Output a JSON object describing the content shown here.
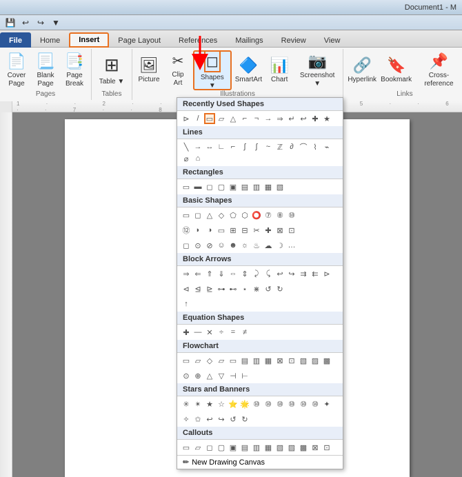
{
  "titlebar": {
    "title": "Document1 - M"
  },
  "quickaccess": {
    "buttons": [
      "save",
      "undo",
      "redo",
      "customize"
    ]
  },
  "tabs": [
    {
      "id": "file",
      "label": "File"
    },
    {
      "id": "home",
      "label": "Home"
    },
    {
      "id": "insert",
      "label": "Insert",
      "active": true
    },
    {
      "id": "page-layout",
      "label": "Page Layout"
    },
    {
      "id": "references",
      "label": "References"
    },
    {
      "id": "mailings",
      "label": "Mailings"
    },
    {
      "id": "review",
      "label": "Review"
    },
    {
      "id": "view",
      "label": "View"
    }
  ],
  "ribbon": {
    "groups": [
      {
        "id": "pages",
        "label": "Pages",
        "buttons": [
          {
            "id": "cover-page",
            "label": "Cover\nPage",
            "icon": "📄"
          },
          {
            "id": "blank-page",
            "label": "Blank\nPage",
            "icon": "📃"
          },
          {
            "id": "page-break",
            "label": "Page\nBreak",
            "icon": "📑"
          }
        ]
      },
      {
        "id": "tables",
        "label": "Tables",
        "buttons": [
          {
            "id": "table",
            "label": "Table",
            "icon": "⊞"
          }
        ]
      },
      {
        "id": "illustrations",
        "label": "Illustrations",
        "buttons": [
          {
            "id": "picture",
            "label": "Picture",
            "icon": "🖼"
          },
          {
            "id": "clip-art",
            "label": "Clip\nArt",
            "icon": "✂"
          },
          {
            "id": "shapes",
            "label": "Shapes",
            "icon": "◻",
            "active": true
          },
          {
            "id": "smartart",
            "label": "SmartArt",
            "icon": "🔷"
          },
          {
            "id": "chart",
            "label": "Chart",
            "icon": "📊"
          },
          {
            "id": "screenshot",
            "label": "Screenshot",
            "icon": "📷"
          }
        ]
      },
      {
        "id": "links",
        "label": "Links",
        "buttons": [
          {
            "id": "hyperlink",
            "label": "Hyperlink",
            "icon": "🔗"
          },
          {
            "id": "bookmark",
            "label": "Bookmark",
            "icon": "🔖"
          },
          {
            "id": "cross-reference",
            "label": "Cross-reference",
            "icon": "📌"
          }
        ]
      }
    ]
  },
  "shapes_dropdown": {
    "title": "Recently Used Shapes",
    "sections": [
      {
        "id": "recently-used",
        "label": "Recently Used Shapes",
        "shapes": [
          "◸",
          "╲",
          "▭",
          "▱",
          "△",
          "⌐",
          "⌐",
          "→",
          "⇒",
          "↵",
          "↩",
          "⊹",
          "★"
        ]
      },
      {
        "id": "lines",
        "label": "Lines",
        "shapes": [
          "╲",
          "╲╲",
          "∫∫",
          "∫",
          "∫",
          "∫",
          "∫",
          "~",
          "~",
          "~",
          "~",
          "~",
          "~",
          "~",
          "~"
        ]
      },
      {
        "id": "rectangles",
        "label": "Rectangles",
        "shapes": [
          "▭",
          "▭",
          "▭",
          "▭",
          "▭",
          "▭",
          "▭",
          "▭",
          "▭"
        ]
      },
      {
        "id": "basic-shapes",
        "label": "Basic Shapes",
        "shapes": [
          "▭",
          "◻",
          "△",
          "◇",
          "⬠",
          "⬡",
          "⭕",
          "⑦",
          "⑧",
          "⑨",
          "⑩",
          "⑪",
          "⑫",
          "◗",
          "◑",
          "◻",
          "▭",
          "▭",
          "✂",
          "✚",
          "⊞",
          "⊟",
          "⊟",
          "⊠",
          "⊡",
          "⊢",
          "⊣",
          "◻",
          "⊙",
          "⊘",
          "☺",
          "☺",
          "☺",
          "☀",
          "☀",
          "☂",
          "☽",
          "⋯"
        ]
      },
      {
        "id": "block-arrows",
        "label": "Block Arrows",
        "shapes": [
          "⇒",
          "⇐",
          "⇑",
          "⇓",
          "⇔",
          "⇕",
          "⤻",
          "⤸",
          "↩",
          "↪",
          "⇉",
          "⇇",
          "⊳",
          "⊲",
          "⊲",
          "⊲",
          "⊲",
          "⊲",
          "⊲",
          "⊲",
          "⊲",
          "⊲",
          "⊲",
          "↺",
          "↺",
          "⊙",
          "⊙",
          "↑"
        ]
      },
      {
        "id": "equation-shapes",
        "label": "Equation Shapes",
        "shapes": [
          "✚",
          "—",
          "÷",
          "=",
          "≠",
          "≡"
        ]
      },
      {
        "id": "flowchart",
        "label": "Flowchart",
        "shapes": [
          "▭",
          "▱",
          "◇",
          "▭",
          "▭",
          "▭",
          "▭",
          "▭",
          "▭",
          "▭",
          "▭",
          "▭",
          "▭",
          "▭",
          "⊙",
          "⊕",
          "△",
          "▽",
          "⊡",
          "⊢"
        ]
      },
      {
        "id": "stars-banners",
        "label": "Stars and Banners",
        "shapes": [
          "✳",
          "✳",
          "★",
          "☆",
          "⭐",
          "⭐",
          "⭐",
          "⭐",
          "⑩",
          "⑩",
          "⑩",
          "⑩",
          "⑩",
          "⑩",
          "⊛",
          "⊛",
          "↩",
          "↩",
          "↺",
          "↺"
        ]
      },
      {
        "id": "callouts",
        "label": "Callouts",
        "shapes": [
          "▭",
          "▱",
          "◻",
          "◻",
          "◻",
          "◻",
          "◻",
          "◻",
          "◻",
          "◻",
          "◻",
          "◻",
          "◻"
        ]
      }
    ],
    "new_drawing_canvas": "New Drawing Canvas"
  }
}
